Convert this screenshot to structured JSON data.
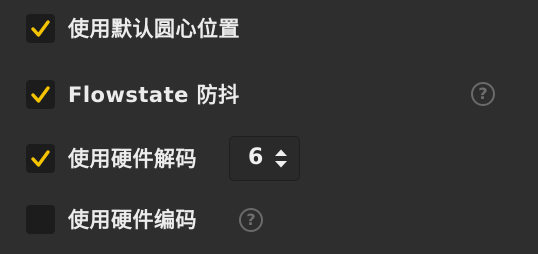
{
  "settings": {
    "use_default_center": {
      "label": "使用默认圆心位置",
      "checked": true
    },
    "flowstate": {
      "label": "Flowstate 防抖",
      "checked": true,
      "help": "?"
    },
    "hw_decode": {
      "label": "使用硬件解码",
      "checked": true,
      "value": "6"
    },
    "hw_encode": {
      "label": "使用硬件编码",
      "checked": false,
      "help": "?"
    }
  },
  "colors": {
    "checkmark": "#f5c400",
    "background": "#2e2e2e",
    "checkbox_bg": "#1c1c1c"
  },
  "icons": {
    "check": "check-icon",
    "help": "help-circle-icon",
    "stepper": "up-down-arrows-icon"
  }
}
